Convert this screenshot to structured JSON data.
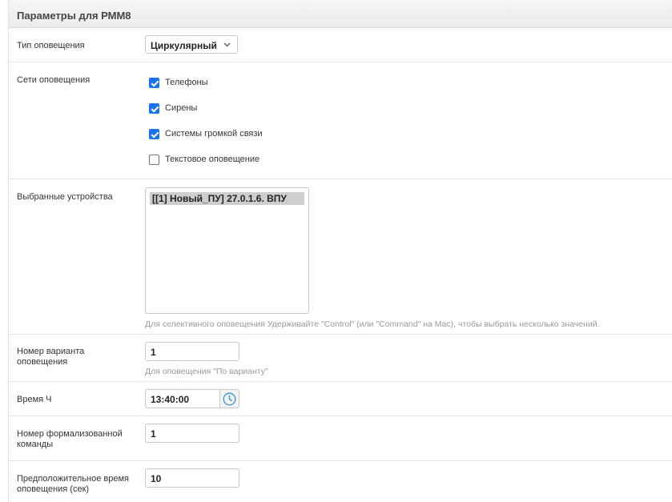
{
  "title": "Параметры для РММ8",
  "notification_type": {
    "label": "Тип оповещения",
    "value": "Циркулярный"
  },
  "networks": {
    "label": "Сети оповещения",
    "items": [
      {
        "label": "Телефоны",
        "checked": true
      },
      {
        "label": "Сирены",
        "checked": true
      },
      {
        "label": "Системы громкой связи",
        "checked": true
      },
      {
        "label": "Текстовое оповещение",
        "checked": false
      }
    ]
  },
  "devices": {
    "label": "Выбранные устройства",
    "options": [
      "[[1] Новый_ПУ] 27.0.1.6. ВПУ"
    ],
    "help": "Для селективного оповещения Удерживайте \"Control\" (или \"Command\" на Mac), чтобы выбрать несколько значений."
  },
  "variant": {
    "label": "Номер варианта оповещения",
    "value": "1",
    "help": "Для оповещения \"По варианту\""
  },
  "time_h": {
    "label": "Время Ч",
    "value": "13:40:00"
  },
  "command": {
    "label": "Номер формализованной команды",
    "value": "1"
  },
  "duration": {
    "label": "Предположительное время оповещения (сек)",
    "value": "10"
  },
  "colors": {
    "checkbox_checked": "#1a73e8",
    "clock_icon": "#3a8fd0"
  }
}
